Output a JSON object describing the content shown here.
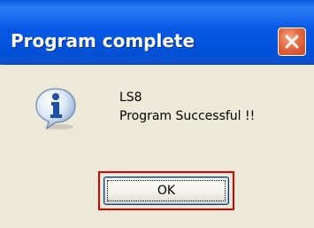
{
  "window": {
    "title": "Program complete",
    "close_icon": "close-icon",
    "close_color": "#e56a3f",
    "title_bar_color": "#0858e6"
  },
  "message": {
    "icon": "info-icon",
    "line1": "LS8",
    "line2": "Program Successful !!"
  },
  "buttons": {
    "ok_label": "OK"
  },
  "highlight": {
    "color": "#e00000"
  }
}
